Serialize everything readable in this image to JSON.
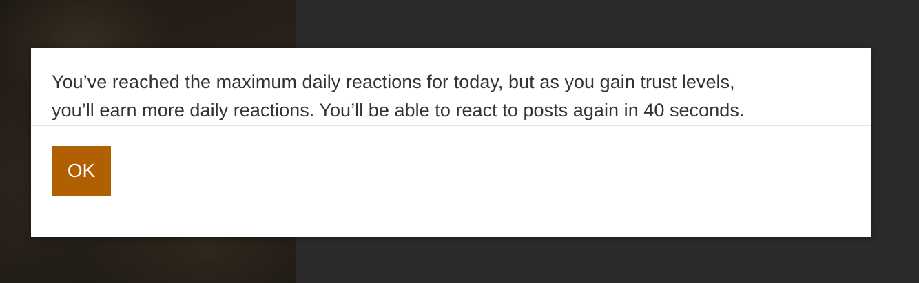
{
  "dialog": {
    "message_line1": "You’ve reached the maximum daily reactions for today, but as you gain trust levels,",
    "message_line2": "you’ll earn more daily reactions. You’ll be able to react to posts again in 40 seconds.",
    "ok_label": "OK"
  },
  "colors": {
    "button_bg": "#b06000",
    "overlay_bg": "#2b2b2b",
    "dialog_bg": "#ffffff",
    "text": "#333333"
  }
}
